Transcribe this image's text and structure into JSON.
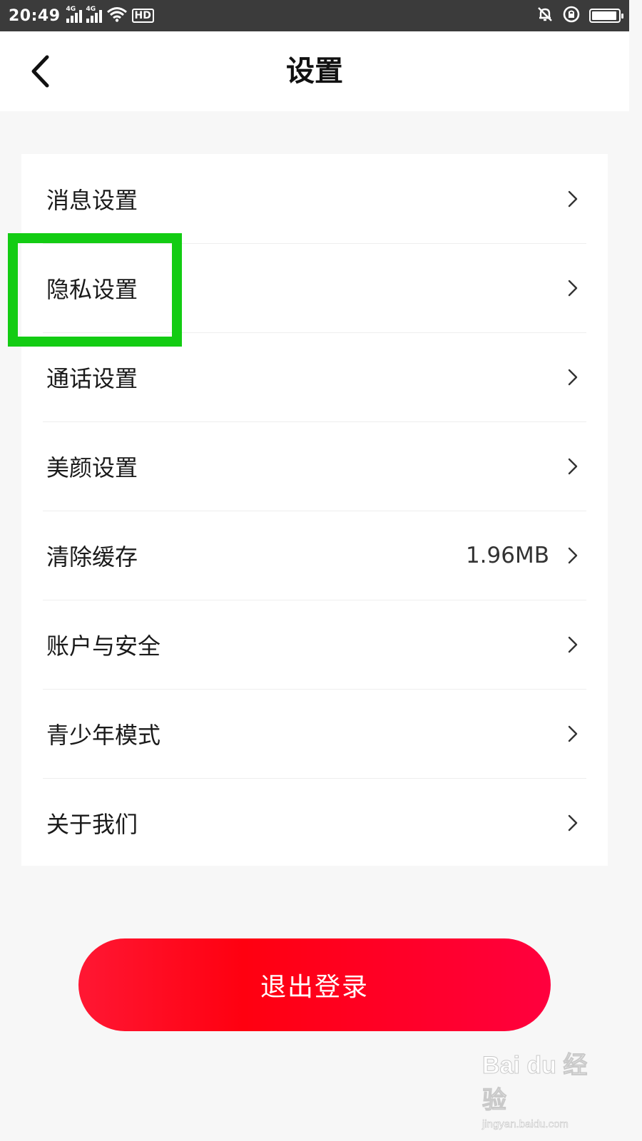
{
  "status_bar": {
    "time": "20:49",
    "network_labels": [
      "4G",
      "4G"
    ],
    "hd_label": "HD",
    "icons": [
      "signal-icon",
      "signal-icon",
      "wifi-icon",
      "hd-icon",
      "mute-icon",
      "rotation-lock-icon",
      "battery-icon"
    ],
    "battery_level": 0.95
  },
  "header": {
    "title": "设置",
    "back_icon": "chevron-left-icon"
  },
  "settings": {
    "items": [
      {
        "label": "消息设置",
        "value": "",
        "icon": "chevron-right-icon"
      },
      {
        "label": "隐私设置",
        "value": "",
        "icon": "chevron-right-icon"
      },
      {
        "label": "通话设置",
        "value": "",
        "icon": "chevron-right-icon"
      },
      {
        "label": "美颜设置",
        "value": "",
        "icon": "chevron-right-icon"
      },
      {
        "label": "清除缓存",
        "value": "1.96MB",
        "icon": "chevron-right-icon"
      },
      {
        "label": "账户与安全",
        "value": "",
        "icon": "chevron-right-icon"
      },
      {
        "label": "青少年模式",
        "value": "",
        "icon": "chevron-right-icon"
      },
      {
        "label": "关于我们",
        "value": "",
        "icon": "chevron-right-icon"
      }
    ]
  },
  "logout": {
    "label": "退出登录"
  },
  "colors": {
    "highlight": "#13cc13",
    "logout_button": "#ff0022",
    "background": "#f7f7f7"
  },
  "watermark": {
    "logo": "Bai du 经验",
    "url": "jingyan.baidu.com"
  }
}
